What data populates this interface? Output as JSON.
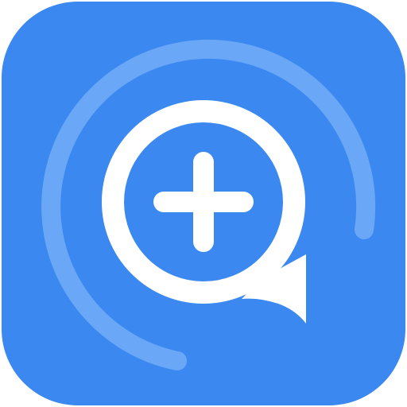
{
  "app_icon": {
    "colors": {
      "tile_background": "#3B89F0",
      "ring_arc": "#6AA8F7",
      "glyph": "#FFFFFF"
    },
    "icons": {
      "tile": "rounded-square-tile",
      "ring": "progress-ring-arc",
      "bubble": "speech-bubble",
      "plus": "plus-icon"
    }
  }
}
